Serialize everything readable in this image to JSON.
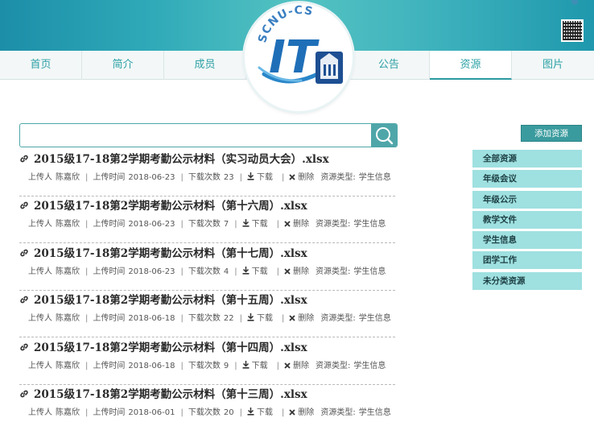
{
  "logo": {
    "text": "SCNU-CS",
    "mark": "IT"
  },
  "nav": {
    "items": [
      {
        "label": "首页"
      },
      {
        "label": "简介"
      },
      {
        "label": "成员"
      },
      {
        "label": "公告"
      },
      {
        "label": "资源"
      },
      {
        "label": "图片"
      }
    ],
    "active": "资源"
  },
  "search": {
    "value": "",
    "placeholder": ""
  },
  "meta_labels": {
    "uploader": "上传人",
    "upload_time": "上传时间",
    "download_count": "下载次数",
    "download": "下载",
    "delete": "删除",
    "resource_type": "资源类型:"
  },
  "resources": [
    {
      "title": "2015级17-18第2学期考勤公示材料（实习动员大会）.xlsx",
      "uploader": "陈嘉欣",
      "time": "2018-06-23",
      "downloads": "23",
      "type": "学生信息"
    },
    {
      "title": "2015级17-18第2学期考勤公示材料（第十六周）.xlsx",
      "uploader": "陈嘉欣",
      "time": "2018-06-23",
      "downloads": "7",
      "type": "学生信息"
    },
    {
      "title": "2015级17-18第2学期考勤公示材料（第十七周）.xlsx",
      "uploader": "陈嘉欣",
      "time": "2018-06-23",
      "downloads": "4",
      "type": "学生信息"
    },
    {
      "title": "2015级17-18第2学期考勤公示材料（第十五周）.xlsx",
      "uploader": "陈嘉欣",
      "time": "2018-06-18",
      "downloads": "22",
      "type": "学生信息"
    },
    {
      "title": "2015级17-18第2学期考勤公示材料（第十四周）.xlsx",
      "uploader": "陈嘉欣",
      "time": "2018-06-18",
      "downloads": "9",
      "type": "学生信息"
    },
    {
      "title": "2015级17-18第2学期考勤公示材料（第十三周）.xlsx",
      "uploader": "陈嘉欣",
      "time": "2018-06-01",
      "downloads": "20",
      "type": "学生信息"
    }
  ],
  "sidebar": {
    "add_button": "添加资源",
    "categories": [
      {
        "label": "全部资源"
      },
      {
        "label": "年级会议"
      },
      {
        "label": "年级公示"
      },
      {
        "label": "教学文件"
      },
      {
        "label": "学生信息"
      },
      {
        "label": "团学工作"
      },
      {
        "label": "未分类资源"
      }
    ]
  },
  "colors": {
    "accent": "#3a9b9e",
    "category_bg": "#9fe0e0",
    "nav_text": "#2da1a6"
  }
}
